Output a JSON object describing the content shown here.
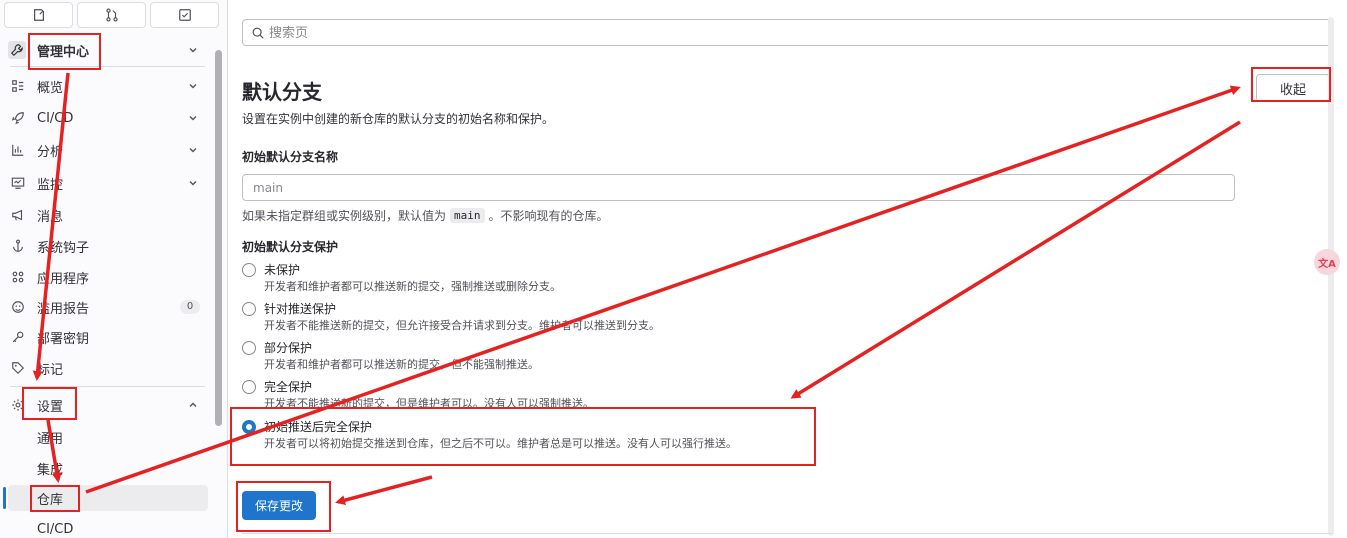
{
  "sidebar": {
    "top_buttons": [
      {
        "icon": "issues-icon"
      },
      {
        "icon": "merge-request-icon"
      },
      {
        "icon": "todo-icon"
      }
    ],
    "admin_label": "管理中心",
    "items": [
      {
        "label": "概览",
        "icon": "overview-icon",
        "chevron": true
      },
      {
        "label": "CI/CD",
        "icon": "rocket-icon",
        "chevron": true
      },
      {
        "label": "分析",
        "icon": "analytics-icon",
        "chevron": true
      },
      {
        "label": "监控",
        "icon": "monitor-icon",
        "chevron": true
      },
      {
        "label": "消息",
        "icon": "bullhorn-icon"
      },
      {
        "label": "系统钩子",
        "icon": "anchor-icon"
      },
      {
        "label": "应用程序",
        "icon": "apps-icon"
      },
      {
        "label": "滥用报告",
        "icon": "smiley-icon",
        "badge": "0"
      },
      {
        "label": "部署密钥",
        "icon": "key-icon"
      },
      {
        "label": "标记",
        "icon": "label-icon"
      }
    ],
    "settings": {
      "label": "设置",
      "icon": "gear-icon",
      "sub": [
        "通用",
        "集成",
        "仓库",
        "CI/CD"
      ],
      "active_index": 2
    }
  },
  "main": {
    "search_placeholder": "搜索页",
    "title": "默认分支",
    "collapse_label": "收起",
    "description": "设置在实例中创建的新仓库的默认分支的初始名称和保护。",
    "initial_name_label": "初始默认分支名称",
    "initial_name_placeholder": "main",
    "help_prefix": "如果未指定群组或实例级别，默认值为",
    "help_code": "main",
    "help_suffix": "。不影响现有的仓库。",
    "protection_label": "初始默认分支保护",
    "protection_options": [
      {
        "label": "未保护",
        "help": "开发者和维护者都可以推送新的提交，强制推送或删除分支。",
        "checked": false
      },
      {
        "label": "针对推送保护",
        "help": "开发者不能推送新的提交，但允许接受合并请求到分支。维护者可以推送到分支。",
        "checked": false
      },
      {
        "label": "部分保护",
        "help": "开发者和维护者都可以推送新的提交，但不能强制推送。",
        "checked": false
      },
      {
        "label": "完全保护",
        "help": "开发者不能推送新的提交，但是维护者可以。没有人可以强制推送。",
        "checked": false
      },
      {
        "label": "初始推送后完全保护",
        "help": "开发者可以将初始提交推送到仓库，但之后不可以。维护者总是可以推送。没有人可以强行推送。",
        "checked": true
      }
    ],
    "save_label": "保存更改",
    "float_icon_text": "文A"
  },
  "colors": {
    "accent": "#1f75cb",
    "annotation": "#e52222"
  }
}
